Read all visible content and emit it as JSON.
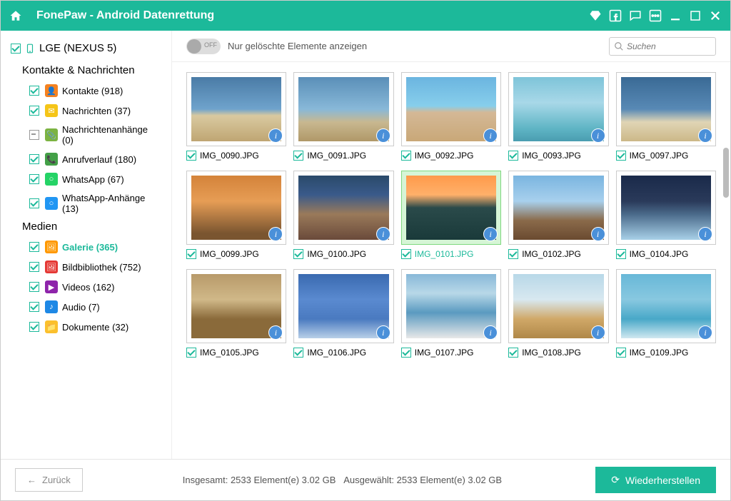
{
  "app": {
    "title": "FonePaw - Android Datenrettung"
  },
  "device": {
    "name": "LGE (NEXUS 5)"
  },
  "sections": {
    "contacts_msgs": {
      "title": "Kontakte & Nachrichten"
    },
    "media": {
      "title": "Medien"
    }
  },
  "categories": [
    {
      "label": "Kontakte",
      "count": 918,
      "checked": true,
      "icon_bg": "#f58220",
      "icon": "👤"
    },
    {
      "label": "Nachrichten",
      "count": 37,
      "checked": true,
      "icon_bg": "#f5c518",
      "icon": "✉"
    },
    {
      "label": "Nachrichtenanhänge",
      "count": 0,
      "checked": "indeterminate",
      "icon_bg": "#7cb342",
      "icon": "📎"
    },
    {
      "label": "Anrufverlauf",
      "count": 180,
      "checked": true,
      "icon_bg": "#43a047",
      "icon": "📞"
    },
    {
      "label": "WhatsApp",
      "count": 67,
      "checked": true,
      "icon_bg": "#25d366",
      "icon": "○"
    },
    {
      "label": "WhatsApp-Anhänge",
      "count": 13,
      "checked": true,
      "icon_bg": "#2196f3",
      "icon": "○"
    }
  ],
  "media_categories": [
    {
      "label": "Galerie",
      "count": 365,
      "checked": true,
      "active": true,
      "icon_bg": "#ff9800",
      "icon": "🖼"
    },
    {
      "label": "Bildbibliothek",
      "count": 752,
      "checked": true,
      "icon_bg": "#e53935",
      "icon": "🖼"
    },
    {
      "label": "Videos",
      "count": 162,
      "checked": true,
      "icon_bg": "#8e24aa",
      "icon": "▶"
    },
    {
      "label": "Audio",
      "count": 7,
      "checked": true,
      "icon_bg": "#1e88e5",
      "icon": "♪"
    },
    {
      "label": "Dokumente",
      "count": 32,
      "checked": true,
      "icon_bg": "#fbc02d",
      "icon": "📁"
    }
  ],
  "toolbar": {
    "toggle_state": "OFF",
    "toggle_label": "Nur gelöschte Elemente anzeigen",
    "search_placeholder": "Suchen"
  },
  "thumbnails": [
    {
      "name": "IMG_0090.JPG",
      "ph": "ph1"
    },
    {
      "name": "IMG_0091.JPG",
      "ph": "ph2"
    },
    {
      "name": "IMG_0092.JPG",
      "ph": "ph"
    },
    {
      "name": "IMG_0093.JPG",
      "ph": "ph3"
    },
    {
      "name": "IMG_0097.JPG",
      "ph": "ph4"
    },
    {
      "name": "IMG_0099.JPG",
      "ph": "ph5"
    },
    {
      "name": "IMG_0100.JPG",
      "ph": "ph6"
    },
    {
      "name": "IMG_0101.JPG",
      "ph": "ph7",
      "selected": true
    },
    {
      "name": "IMG_0102.JPG",
      "ph": "ph8"
    },
    {
      "name": "IMG_0104.JPG",
      "ph": "ph9"
    },
    {
      "name": "IMG_0105.JPG",
      "ph": "ph10"
    },
    {
      "name": "IMG_0106.JPG",
      "ph": "ph11"
    },
    {
      "name": "IMG_0107.JPG",
      "ph": "ph12"
    },
    {
      "name": "IMG_0108.JPG",
      "ph": "ph13"
    },
    {
      "name": "IMG_0109.JPG",
      "ph": "ph14"
    }
  ],
  "footer": {
    "back": "Zurück",
    "total_label": "Insgesamt:",
    "total_value": "2533 Element(e) 3.02 GB",
    "selected_label": "Ausgewählt:",
    "selected_value": "2533 Element(e) 3.02 GB",
    "recover": "Wiederherstellen"
  }
}
